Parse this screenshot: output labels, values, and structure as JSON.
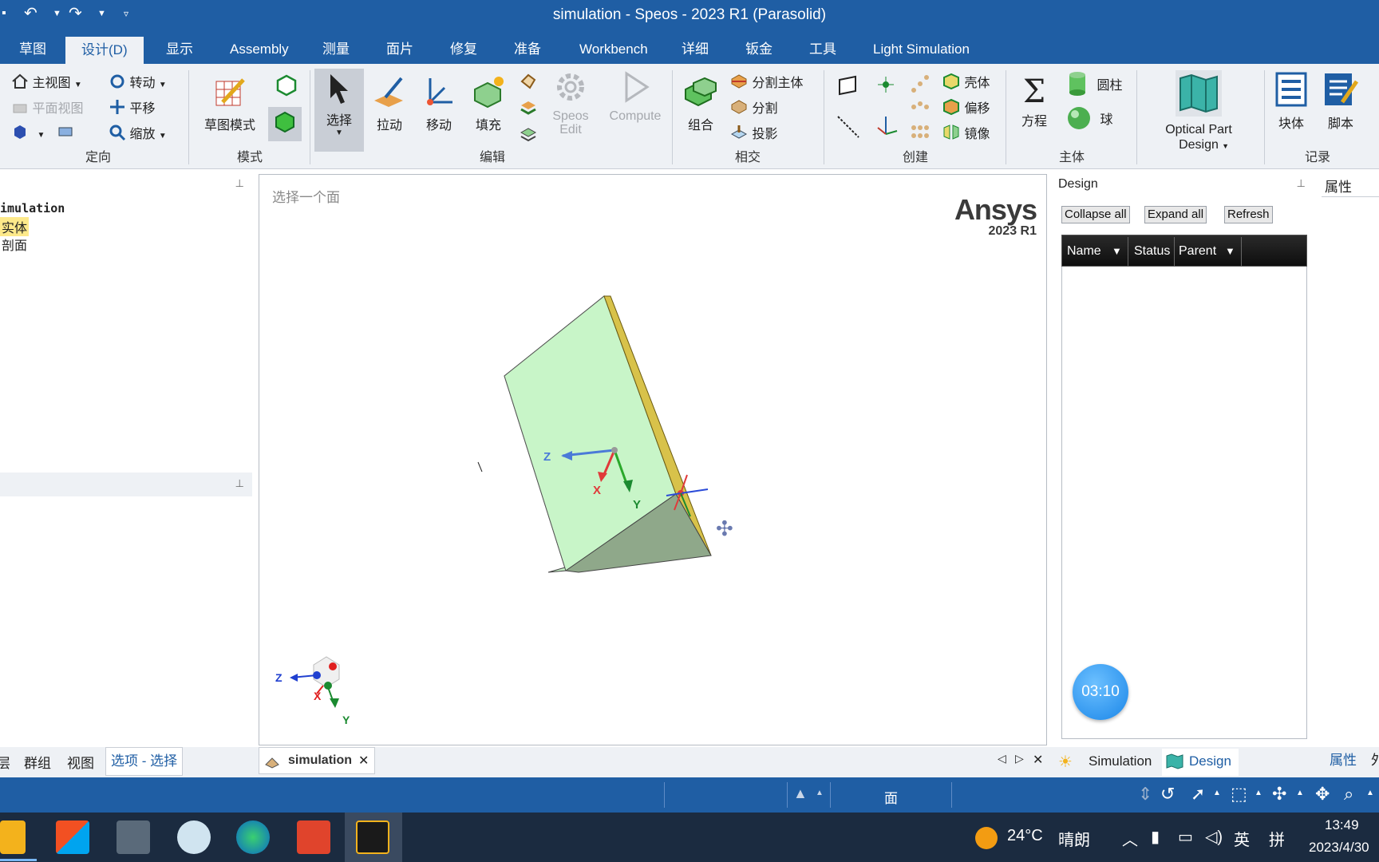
{
  "window": {
    "title": "simulation - Speos - 2023 R1 (Parasolid)"
  },
  "menu": {
    "tabs": [
      "草图",
      "设计(D)",
      "显示",
      "Assembly",
      "测量",
      "面片",
      "修复",
      "准备",
      "Workbench",
      "详细",
      "钣金",
      "工具",
      "Light Simulation"
    ],
    "active": "设计(D)"
  },
  "ribbon": {
    "orient": {
      "label": "定向",
      "home_view": "主视图",
      "plane_view": "平面视图",
      "rotate": "转动",
      "pan": "平移",
      "zoom": "缩放"
    },
    "mode": {
      "label": "模式",
      "sketch_mode": "草图模式"
    },
    "edit": {
      "label": "编辑",
      "select": "选择",
      "pull": "拉动",
      "move": "移动",
      "fill": "填充",
      "speos_edit": "Speos Edit",
      "compute": "Compute"
    },
    "intersect": {
      "label": "相交",
      "combine": "组合",
      "split_body": "分割主体",
      "split": "分割",
      "project": "投影"
    },
    "create": {
      "label": "创建",
      "shell": "壳体",
      "offset": "偏移",
      "mirror": "镜像"
    },
    "body": {
      "label": "主体",
      "equation": "方程",
      "cylinder": "圆柱",
      "sphere": "球"
    },
    "optical": {
      "label": "Optical Part Design"
    },
    "record": {
      "label": "记录",
      "block": "块体",
      "script": "脚本"
    }
  },
  "left_panel": {
    "tree": [
      "imulation",
      "实体",
      "剖面"
    ]
  },
  "viewport": {
    "hint": "选择一个面",
    "logo_brand": "Ansys",
    "logo_version": "2023 R1",
    "axes": {
      "z": "Z",
      "x": "X",
      "y": "Y"
    }
  },
  "design_panel": {
    "title": "Design",
    "buttons": [
      "Collapse all",
      "Expand all",
      "Refresh"
    ],
    "columns": [
      "Name",
      "Status",
      "Parent"
    ],
    "timer": "03:10"
  },
  "props_panel": {
    "title": "属性"
  },
  "bottom_tabs": {
    "left": [
      "层",
      "群组",
      "视图",
      "选项 - 选择"
    ],
    "doc_tab": "simulation",
    "right": [
      "Simulation",
      "Design",
      "属性",
      "外"
    ]
  },
  "status_bar": {
    "mode": "面"
  },
  "taskbar": {
    "weather_temp": "24°C",
    "weather_desc": "晴朗",
    "ime": "英",
    "ime2": "拼",
    "time": "13:49",
    "date": "2023/4/30"
  },
  "colors": {
    "titlebar": "#1f5ea4",
    "ribbon_bg": "#eef1f5",
    "face_green": "#c8f5c8",
    "face_dark": "#8fa88a",
    "edge_yellow": "#d8c24a"
  }
}
